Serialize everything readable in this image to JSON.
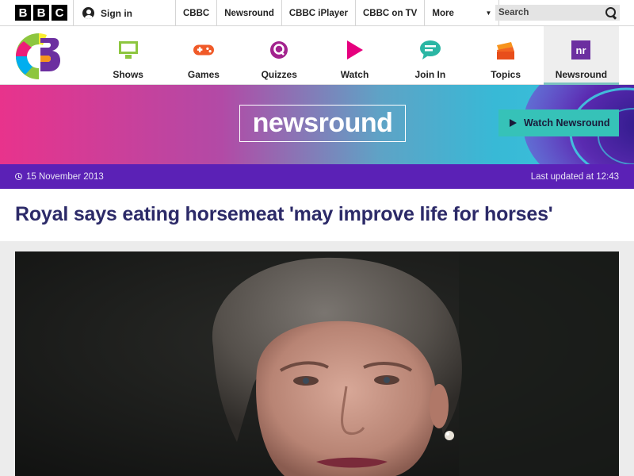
{
  "bbc_bar": {
    "logo_letters": [
      "B",
      "B",
      "C"
    ],
    "signin_label": "Sign in",
    "links": [
      "CBBC",
      "Newsround",
      "CBBC iPlayer",
      "CBBC on TV"
    ],
    "more_label": "More",
    "search_placeholder": "Search"
  },
  "cbbc_nav": {
    "items": [
      {
        "label": "Shows",
        "icon": "monitor-icon",
        "color": "#8dc63f"
      },
      {
        "label": "Games",
        "icon": "gamepad-icon",
        "color": "#f05a28"
      },
      {
        "label": "Quizzes",
        "icon": "quiz-icon",
        "color": "#a3238e"
      },
      {
        "label": "Watch",
        "icon": "play-icon",
        "color": "#e6007e"
      },
      {
        "label": "Join In",
        "icon": "chat-icon",
        "color": "#2bb6a4"
      },
      {
        "label": "Topics",
        "icon": "folder-icon",
        "color": "#f26522"
      },
      {
        "label": "Newsround",
        "icon": "newsround-icon",
        "color": "#6c2fa0"
      }
    ]
  },
  "banner": {
    "logo_text": "newsround",
    "watch_button_label": "Watch Newsround"
  },
  "article": {
    "date": "15 November 2013",
    "last_updated": "Last updated at 12:43",
    "headline": "Royal says eating horsemeat 'may improve life for horses'"
  },
  "colors": {
    "accent_purple": "#5b21b6",
    "headline_navy": "#2c2a68",
    "watch_button": "#36c2b8"
  }
}
